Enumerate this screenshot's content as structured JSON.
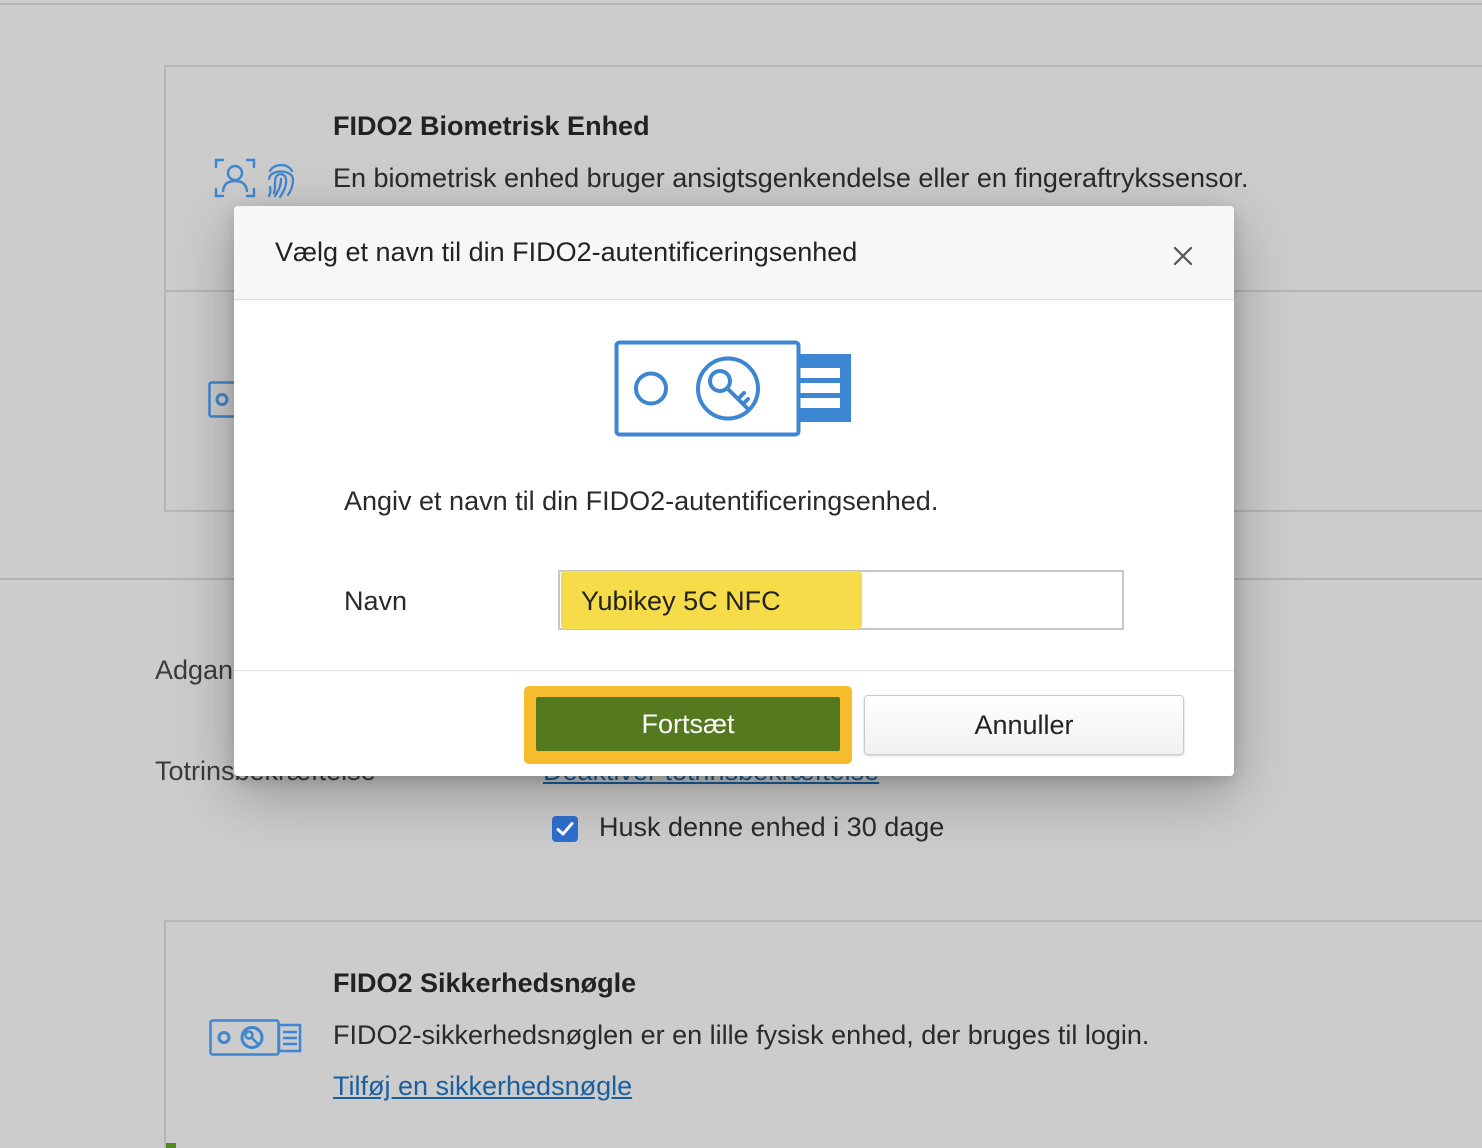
{
  "background": {
    "biometric_card": {
      "title": "FIDO2 Biometrisk Enhed",
      "description": "En biometrisk enhed bruger ansigtsgenkendelse eller en fingeraftrykssensor.",
      "icons": [
        "face-scan-icon",
        "fingerprint-icon"
      ]
    },
    "access_label": "Adgan",
    "two_step_label": "Totrinsbekræftelse",
    "two_step_link": "Deaktiver totrinsbekræftelse",
    "remember_device": {
      "label": "Husk denne enhed i 30 dage",
      "checked": true
    },
    "security_key_card": {
      "title": "FIDO2 Sikkerhedsnøgle",
      "description": "FIDO2-sikkerhedsnøglen er en lille fysisk enhed, der bruges til login.",
      "link": "Tilføj en sikkerhedsnøgle",
      "icon": "security-key-icon"
    }
  },
  "modal": {
    "title": "Vælg et navn til din FIDO2-autentificeringsenhed",
    "close_icon": "close-icon",
    "hero_icon": "usb-security-key-icon",
    "prompt": "Angiv et navn til din FIDO2-autentificeringsenhed.",
    "name_field": {
      "label": "Navn",
      "value": "Yubikey 5C NFC"
    },
    "continue_label": "Fortsæt",
    "cancel_label": "Annuller"
  },
  "colors": {
    "accent_blue": "#3d86d1",
    "link_blue": "#1a5f9e",
    "continue_green": "#55791f",
    "highlight_yellow": "#f7dc49",
    "focus_outline": "#f5bc2e"
  }
}
